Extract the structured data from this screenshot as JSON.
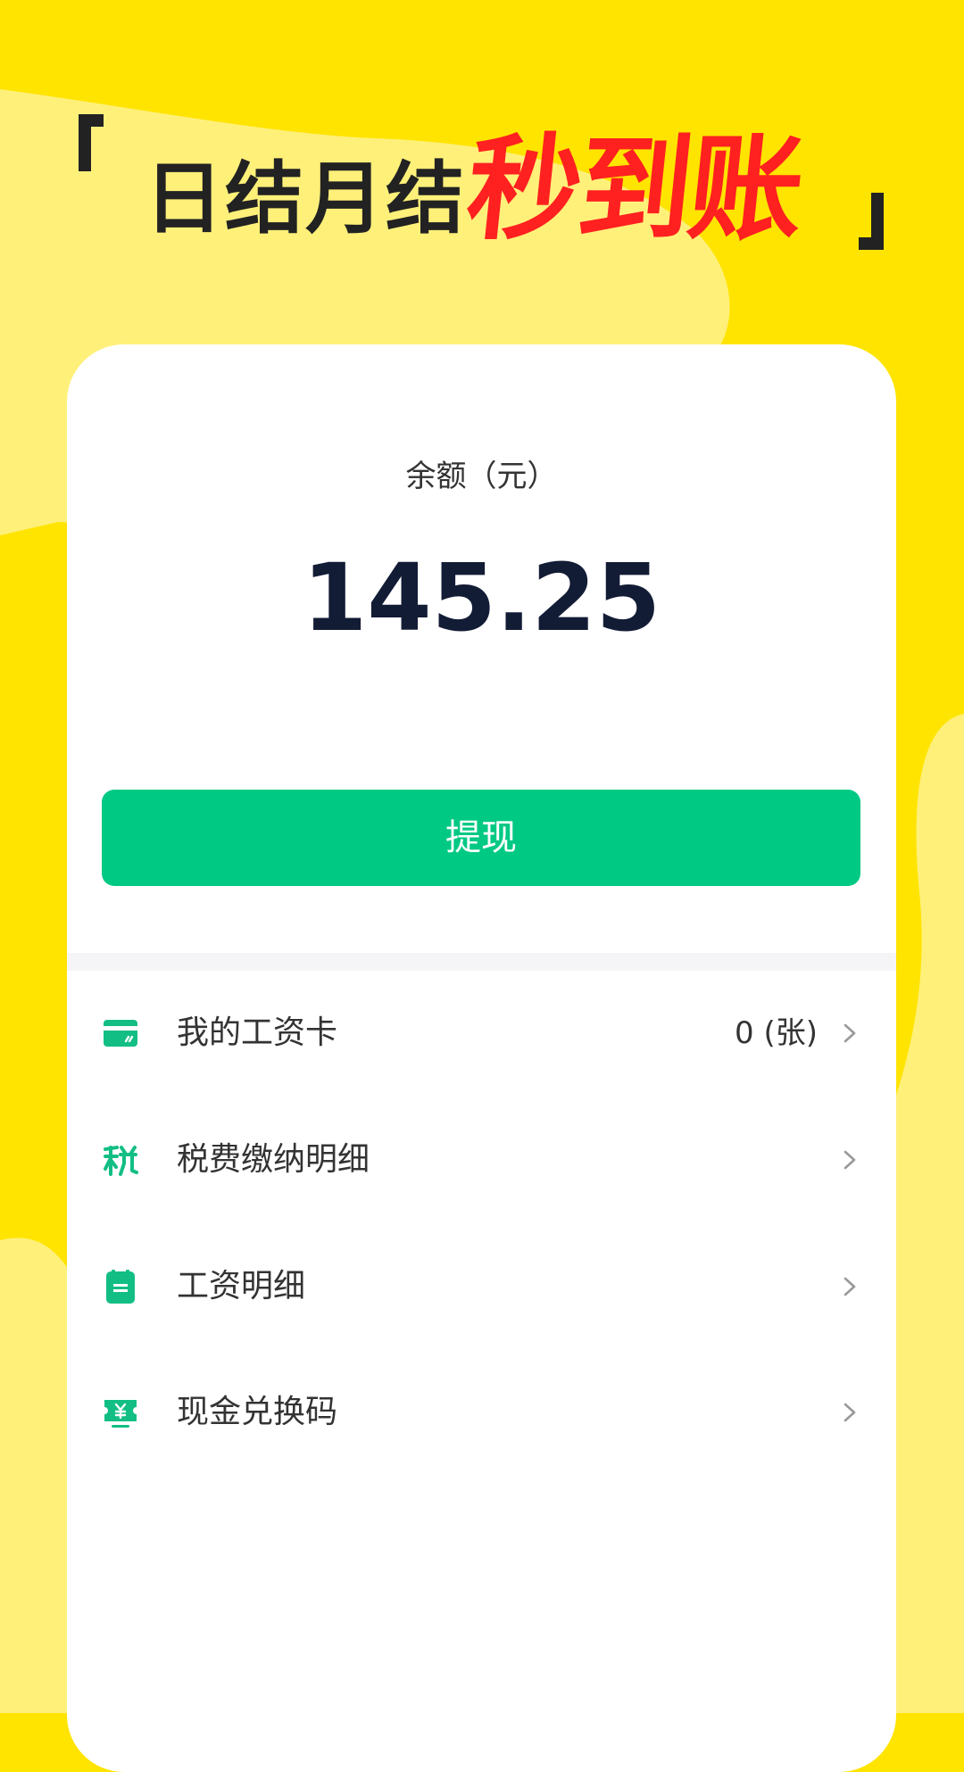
{
  "headline": {
    "text_black": "日结月结",
    "text_red": "秒到账"
  },
  "balance": {
    "label": "余额（元）",
    "value": "145.25"
  },
  "withdraw_button": {
    "label": "提现"
  },
  "menu": [
    {
      "icon": "card-icon",
      "label": "我的工资卡",
      "value": "0 (张)"
    },
    {
      "icon": "tax-icon",
      "label": "税费缴纳明细",
      "value": ""
    },
    {
      "icon": "document-icon",
      "label": "工资明细",
      "value": ""
    },
    {
      "icon": "yen-ticket-icon",
      "label": "现金兑换码",
      "value": ""
    }
  ],
  "colors": {
    "background": "#FFE400",
    "accent_green": "#00C984",
    "headline_red": "#FF2020",
    "balance_text": "#131C35"
  }
}
